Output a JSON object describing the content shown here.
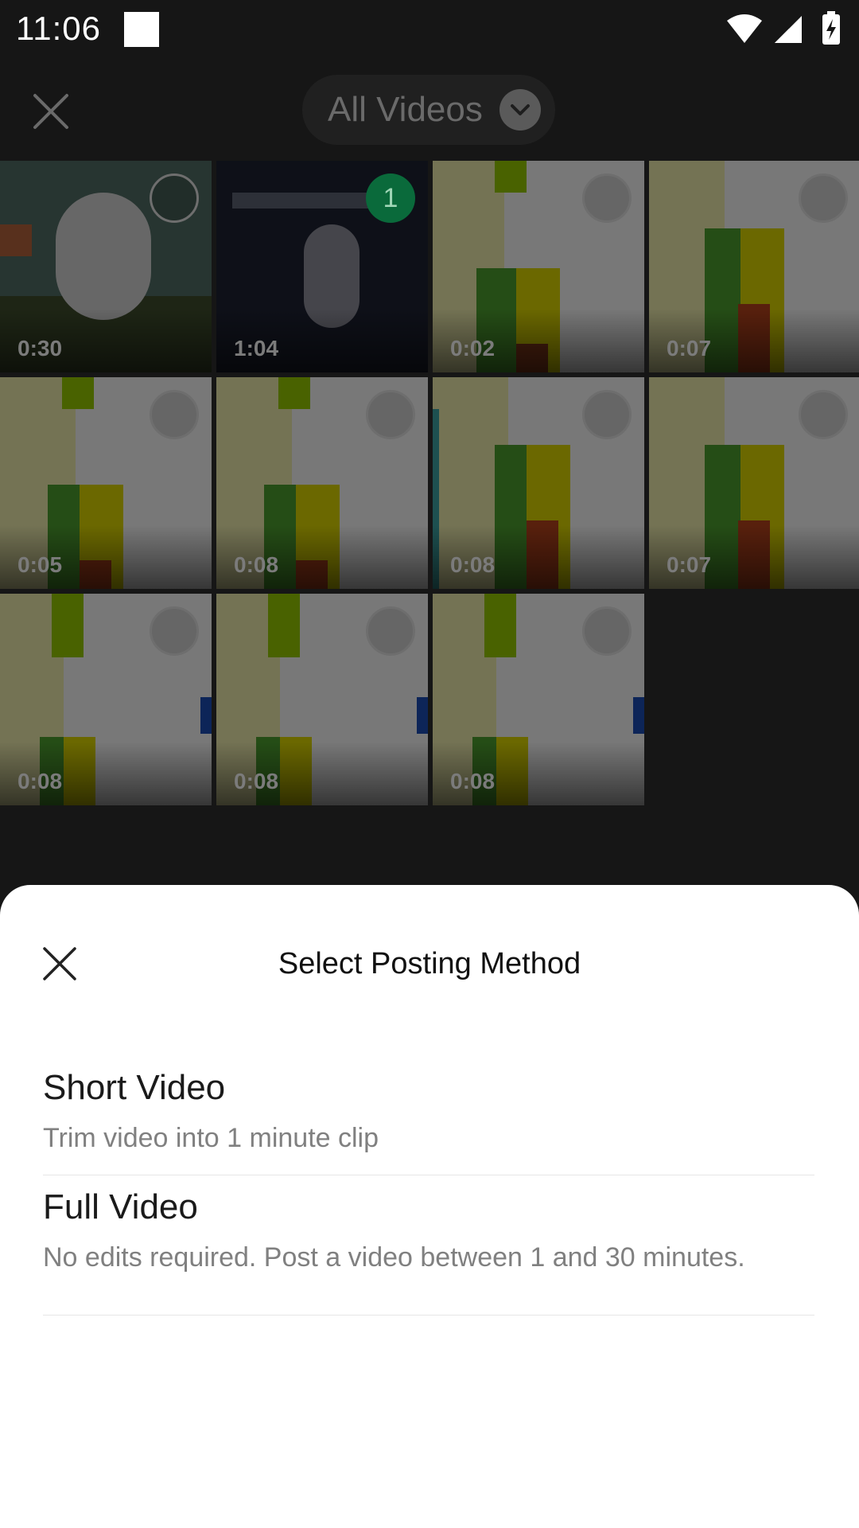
{
  "status_bar": {
    "time": "11:06"
  },
  "top_bar": {
    "album_label": "All Videos"
  },
  "grid": {
    "tiles": [
      {
        "duration": "0:30",
        "selected": false
      },
      {
        "duration": "1:04",
        "selected": true,
        "selection_number": "1"
      },
      {
        "duration": "0:02",
        "selected": false
      },
      {
        "duration": "0:07",
        "selected": false
      },
      {
        "duration": "0:05",
        "selected": false
      },
      {
        "duration": "0:08",
        "selected": false
      },
      {
        "duration": "0:08",
        "selected": false
      },
      {
        "duration": "0:07",
        "selected": false
      },
      {
        "duration": "0:08",
        "selected": false
      },
      {
        "duration": "0:08",
        "selected": false
      },
      {
        "duration": "0:08",
        "selected": false
      }
    ]
  },
  "sheet": {
    "title": "Select Posting Method",
    "options": [
      {
        "title": "Short Video",
        "description": "Trim video into 1 minute clip"
      },
      {
        "title": "Full Video",
        "description": "No edits required. Post a video between 1 and 30 minutes."
      }
    ]
  },
  "colors": {
    "selected_badge": "#0a6a3b",
    "sheet_bg": "#ffffff",
    "dim_bg": "#161616"
  }
}
